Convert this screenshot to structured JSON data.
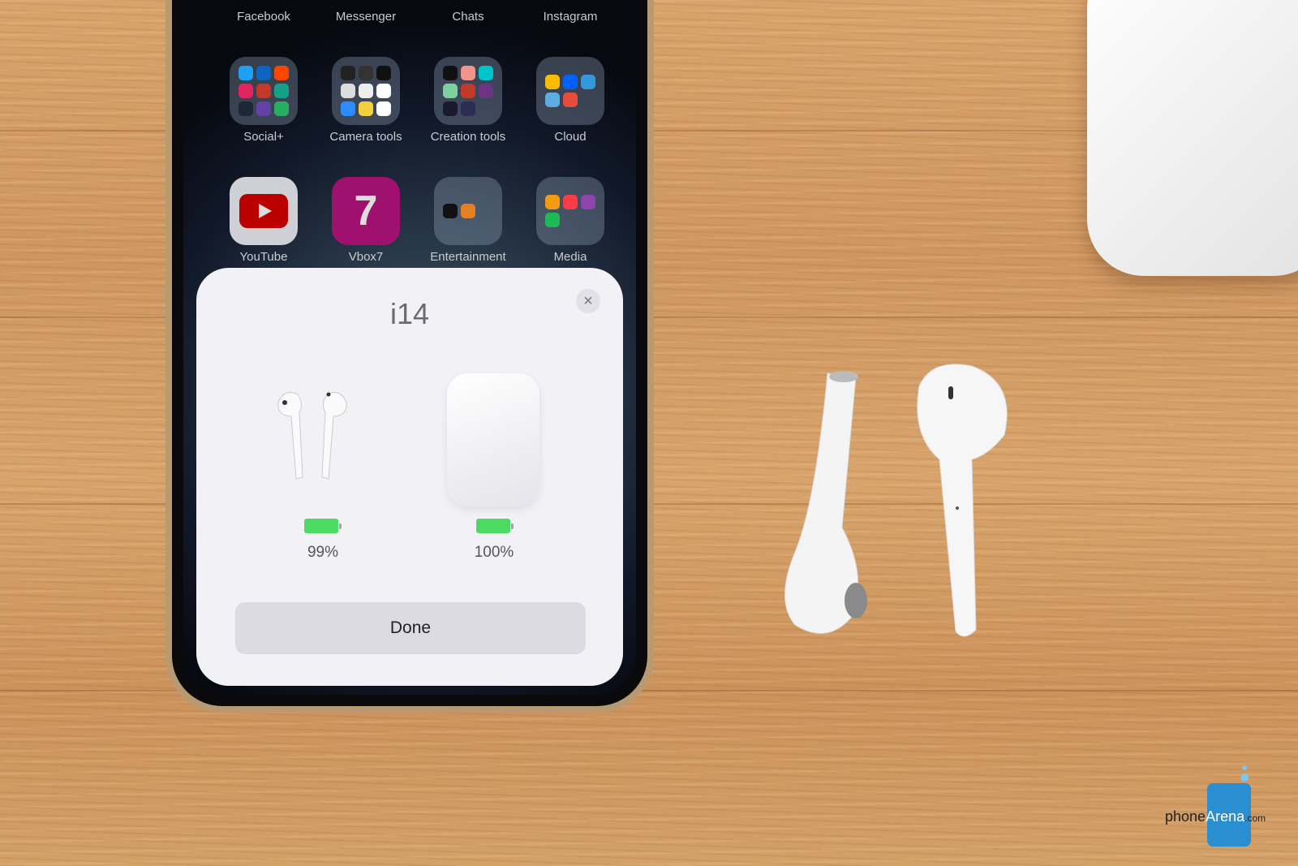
{
  "home_screen": {
    "dock_row": [
      {
        "label": "Facebook"
      },
      {
        "label": "Messenger"
      },
      {
        "label": "Chats"
      },
      {
        "label": "Instagram"
      }
    ],
    "folders_row": [
      {
        "label": "Social+"
      },
      {
        "label": "Camera tools"
      },
      {
        "label": "Creation tools"
      },
      {
        "label": "Cloud"
      }
    ],
    "apps_row": [
      {
        "label": "YouTube",
        "icon": "youtube-icon"
      },
      {
        "label": "Vbox7",
        "icon": "vbox7-icon",
        "glyph": "7"
      },
      {
        "label": "Entertainment",
        "icon": "folder-icon"
      },
      {
        "label": "Media",
        "icon": "folder-icon"
      }
    ]
  },
  "popup": {
    "title": "i14",
    "close_glyph": "×",
    "earbuds": {
      "battery_label": "99%",
      "battery_level": 99
    },
    "case": {
      "battery_label": "100%",
      "battery_level": 100
    },
    "done_label": "Done",
    "battery_color": "#4cd964"
  },
  "watermark": {
    "brand": "phoneArena",
    "phone": "phone",
    "arena": "Arena",
    "suffix": ".com"
  }
}
